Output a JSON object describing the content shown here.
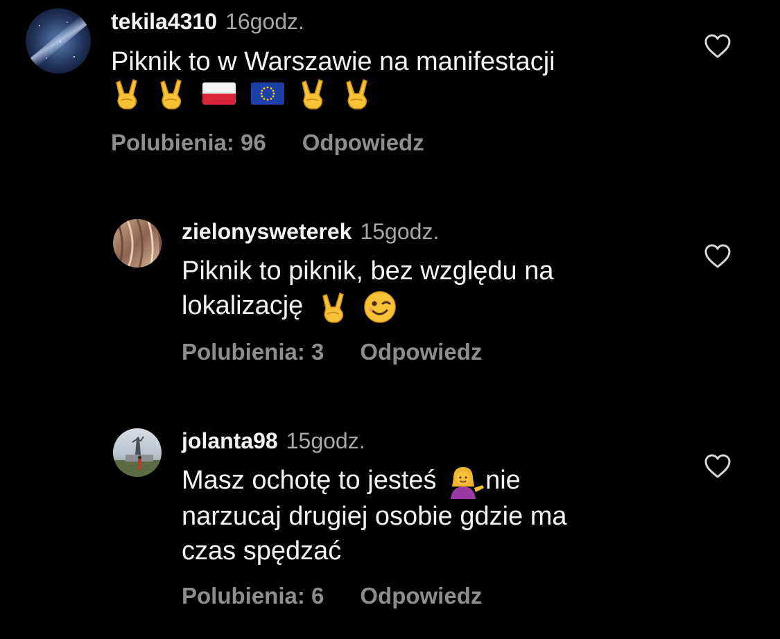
{
  "comments": [
    {
      "username": "tekila4310",
      "time": "16godz.",
      "lines": [
        "Piknik to w Warszawie na manifestacji"
      ],
      "emoji_line": [
        "victory-hand",
        "victory-hand",
        "flag-poland",
        "flag-eu",
        "victory-hand",
        "victory-hand"
      ],
      "likes": "Polubienia: 96",
      "reply": "Odpowiedz"
    },
    {
      "username": "zielonysweterek",
      "time": "15godz.",
      "lines": [
        "Piknik to piknik, bez względu na",
        "lokalizację"
      ],
      "line2_emojis": [
        "victory-hand",
        "winking-face"
      ],
      "likes": "Polubienia: 3",
      "reply": "Odpowiedz"
    },
    {
      "username": "jolanta98",
      "time": "15godz.",
      "line1_start": "Masz ochotę to jesteś",
      "line1_emoji": "tipping-hand-woman",
      "line1_end": "nie",
      "lines": [
        "narzucaj drugiej osobie gdzie ma",
        "czas spędzać"
      ],
      "likes": "Polubienia: 6",
      "reply": "Odpowiedz"
    }
  ],
  "colors": {
    "background": "#000000",
    "primary_text": "#f5f5f5",
    "secondary_text": "#a8a8a8",
    "action_text": "#8e8e8e",
    "heart_outline": "#d8d8d8"
  },
  "icons": {
    "like": "heart-outline-icon"
  }
}
